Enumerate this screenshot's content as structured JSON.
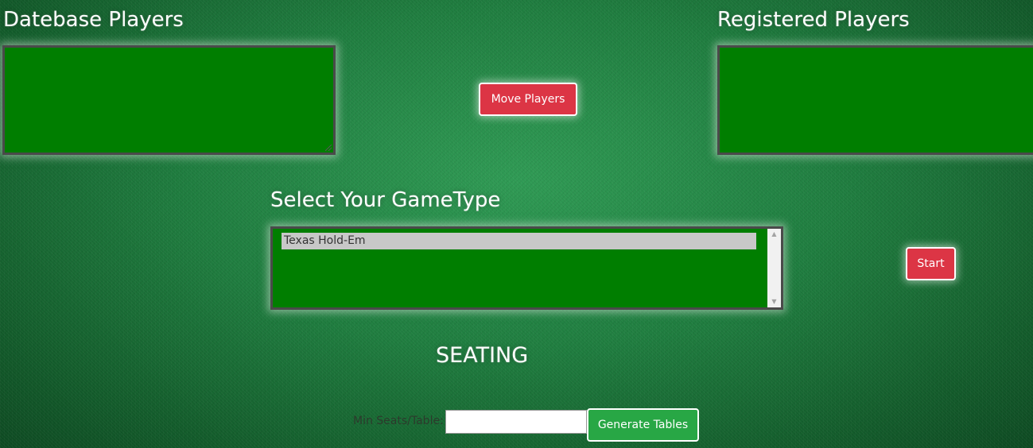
{
  "database_players": {
    "heading": "Datebase Players"
  },
  "registered_players": {
    "heading": "Registered Players"
  },
  "move_players_button": "Move Players",
  "game_type": {
    "heading": "Select Your GameType",
    "options": [
      "Texas Hold-Em"
    ],
    "selected": "Texas Hold-Em"
  },
  "start_button": "Start",
  "seating": {
    "heading": "SEATING",
    "min_seats_label": "Min Seats/Table:",
    "min_seats_value": "",
    "generate_button": "Generate Tables"
  },
  "colors": {
    "listbox_bg": "#007e00",
    "button_red": "#dc3545",
    "button_green": "#28a745"
  },
  "icons": {
    "scroll_up": "scroll-up-arrow-icon",
    "scroll_down": "scroll-down-arrow-icon",
    "resize": "resize-grip-icon"
  }
}
